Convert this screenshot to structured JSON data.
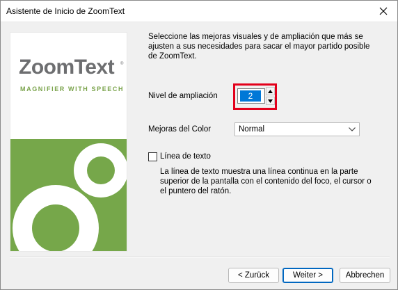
{
  "window": {
    "title": "Asistente de Inicio de ZoomText"
  },
  "logo": {
    "name": "ZoomText",
    "trademark": "®",
    "tagline": "MAGNIFIER WITH SPEECH"
  },
  "intro_text": "Seleccione las mejoras visuales y de ampliación que más se ajusten a sus necesidades para sacar el mayor partido posible de ZoomText.",
  "magnification": {
    "label": "Nivel de ampliación",
    "value": "2"
  },
  "color": {
    "label": "Mejoras del Color",
    "selected": "Normal"
  },
  "text_line": {
    "label": "Línea de texto",
    "checked": false,
    "description": "La línea de texto muestra una línea continua en la parte superior de la pantalla con el contenido del foco, el cursor o el puntero del ratón."
  },
  "buttons": {
    "back": "< Zurück",
    "next": "Weiter >",
    "cancel": "Abbrechen"
  },
  "colors": {
    "highlight": "#e3001b",
    "brand_green": "#76a74a",
    "selection_blue": "#0078d7"
  }
}
